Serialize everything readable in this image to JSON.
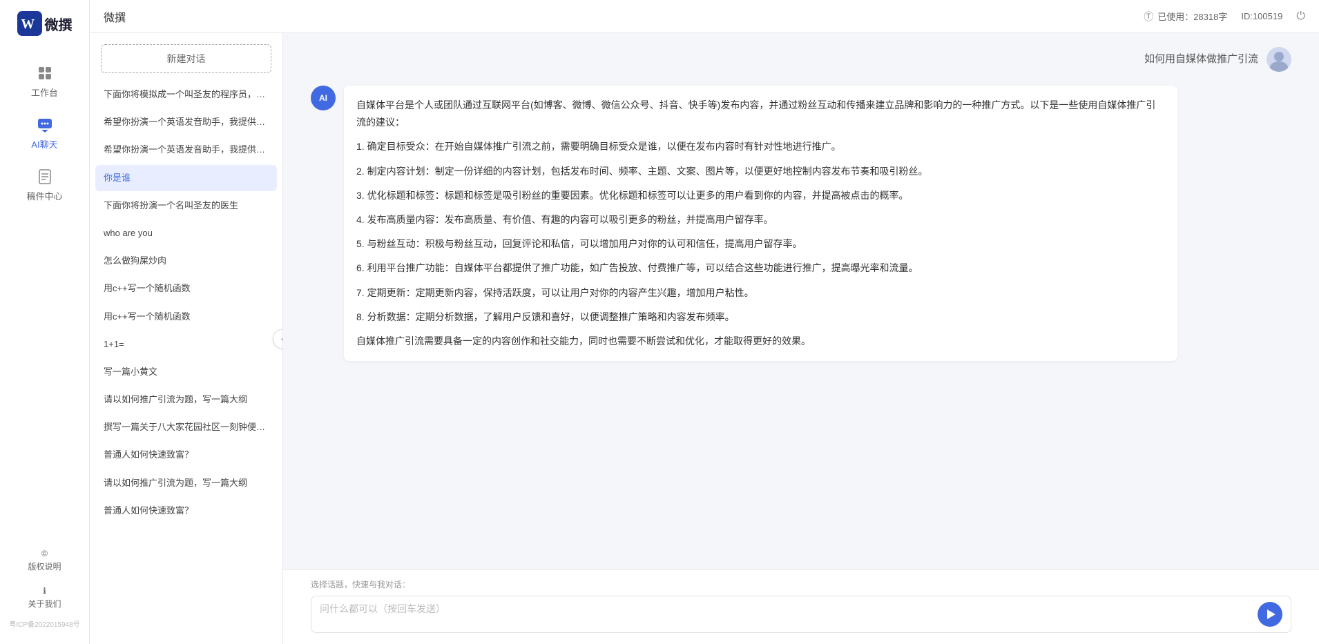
{
  "app": {
    "name": "微撰",
    "title": "微撰"
  },
  "topbar": {
    "title": "微撰",
    "usage_label": "已使用：28318字",
    "usage_icon": "ℹ",
    "id_label": "ID:100519",
    "logout_icon": "⏻"
  },
  "sidebar": {
    "logo_text": "微撰",
    "nav_items": [
      {
        "id": "workbench",
        "label": "工作台",
        "icon": "⊞"
      },
      {
        "id": "ai-chat",
        "label": "AI聊天",
        "icon": "💬",
        "active": true
      },
      {
        "id": "draft",
        "label": "稿件中心",
        "icon": "📄"
      }
    ],
    "bottom_items": [
      {
        "id": "copyright",
        "label": "版权说明",
        "icon": "©"
      },
      {
        "id": "about",
        "label": "关于我们",
        "icon": "ℹ"
      }
    ],
    "icp": "粤ICP备2022015948号"
  },
  "chat_history": {
    "new_chat_label": "新建对话",
    "items": [
      {
        "id": "h1",
        "text": "下面你将模拟成一个叫圣友的程序员，我说..."
      },
      {
        "id": "h2",
        "text": "希望你扮演一个英语发音助手，我提供给你..."
      },
      {
        "id": "h3",
        "text": "希望你扮演一个英语发音助手，我提供给你..."
      },
      {
        "id": "h4",
        "text": "你是谁",
        "active": true
      },
      {
        "id": "h5",
        "text": "下面你将扮演一个名叫圣友的医生"
      },
      {
        "id": "h6",
        "text": "who are you"
      },
      {
        "id": "h7",
        "text": "怎么做狗屎炒肉"
      },
      {
        "id": "h8",
        "text": "用c++写一个随机函数"
      },
      {
        "id": "h9",
        "text": "用c++写一个随机函数"
      },
      {
        "id": "h10",
        "text": "1+1="
      },
      {
        "id": "h11",
        "text": "写一篇小黄文"
      },
      {
        "id": "h12",
        "text": "请以如何推广引流为题，写一篇大纲"
      },
      {
        "id": "h13",
        "text": "撰写一篇关于八大家花园社区一刻钟便民生..."
      },
      {
        "id": "h14",
        "text": "普通人如何快速致富？"
      },
      {
        "id": "h15",
        "text": "请以如何推广引流为题，写一篇大纲"
      },
      {
        "id": "h16",
        "text": "普通人如何快速致富？"
      }
    ]
  },
  "chat": {
    "user_question": "如何用自媒体做推广引流",
    "ai_response": {
      "paragraphs": [
        "自媒体平台是个人或团队通过互联网平台(如博客、微博、微信公众号、抖音、快手等)发布内容，并通过粉丝互动和传播来建立品牌和影响力的一种推广方式。以下是一些使用自媒体推广引流的建议：",
        "1. 确定目标受众：在开始自媒体推广引流之前，需要明确目标受众是谁，以便在发布内容时有针对性地进行推广。",
        "2. 制定内容计划：制定一份详细的内容计划，包括发布时间、频率、主题、文案、图片等，以便更好地控制内容发布节奏和吸引粉丝。",
        "3. 优化标题和标签：标题和标签是吸引粉丝的重要因素。优化标题和标签可以让更多的用户看到你的内容，并提高被点击的概率。",
        "4. 发布高质量内容：发布高质量、有价值、有趣的内容可以吸引更多的粉丝，并提高用户留存率。",
        "5. 与粉丝互动：积极与粉丝互动，回复评论和私信，可以增加用户对你的认可和信任，提高用户留存率。",
        "6. 利用平台推广功能：自媒体平台都提供了推广功能，如广告投放、付费推广等，可以结合这些功能进行推广，提高曝光率和流量。",
        "7. 定期更新：定期更新内容，保持活跃度，可以让用户对你的内容产生兴趣，增加用户粘性。",
        "8. 分析数据：定期分析数据，了解用户反馈和喜好，以便调整推广策略和内容发布频率。",
        "自媒体推广引流需要具备一定的内容创作和社交能力，同时也需要不断尝试和优化，才能取得更好的效果。"
      ]
    }
  },
  "input": {
    "quick_topic": "选择话题，快速与我对话：",
    "placeholder": "问什么都可以（按回车发送）"
  }
}
